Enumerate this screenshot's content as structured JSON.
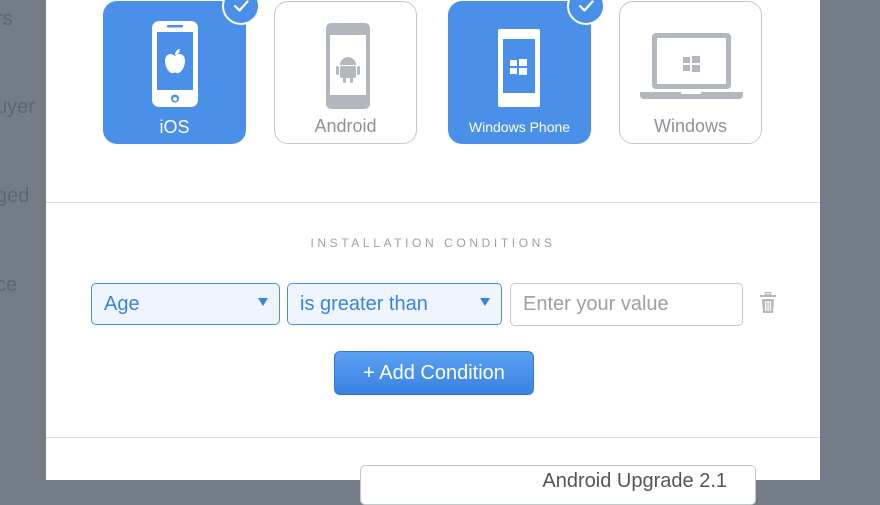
{
  "background": {
    "fragments": [
      "rs",
      "uyer",
      "ged",
      "ce"
    ]
  },
  "platforms": [
    {
      "label": "iOS",
      "selected": true,
      "icon": "iphone-apple-icon"
    },
    {
      "label": "Android",
      "selected": false,
      "icon": "android-phone-icon"
    },
    {
      "label": "Windows Phone",
      "selected": true,
      "icon": "windows-phone-icon"
    },
    {
      "label": "Windows",
      "selected": false,
      "icon": "windows-laptop-icon"
    }
  ],
  "conditions": {
    "title": "INSTALLATION CONDITIONS",
    "field_select": "Age",
    "operator_select": "is greater than",
    "value_placeholder": "Enter your value",
    "add_button": "+ Add Condition"
  },
  "bottom": {
    "field_text": "Android Upgrade 2.1"
  },
  "colors": {
    "accent": "#4a90e8",
    "overlay": "#737c87",
    "muted": "#8c939b"
  }
}
